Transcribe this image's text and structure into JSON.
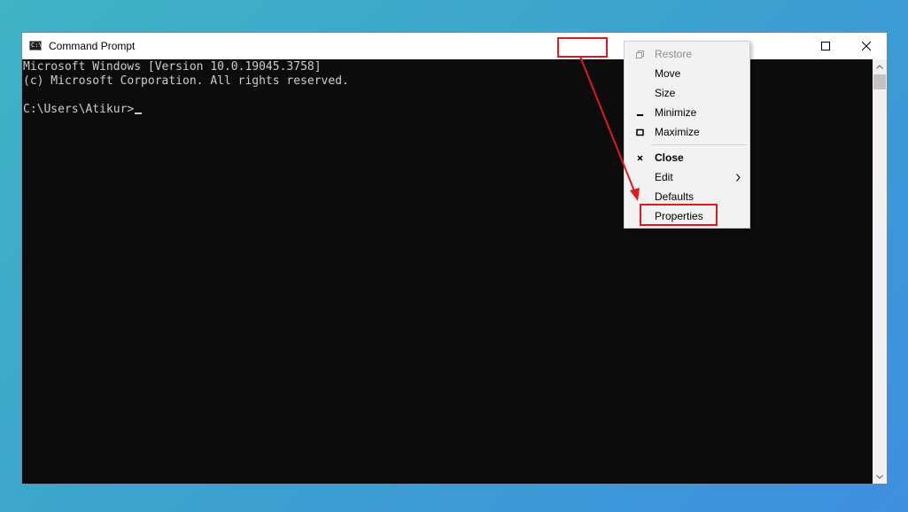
{
  "window": {
    "title": "Command Prompt",
    "app_icon_text": "C:\\"
  },
  "console": {
    "lines": [
      "Microsoft Windows [Version 10.0.19045.3758]",
      "(c) Microsoft Corporation. All rights reserved.",
      "",
      "C:\\Users\\Atikur>"
    ]
  },
  "system_menu": {
    "items": [
      {
        "label": "Restore",
        "icon": "restore-icon",
        "state": "disabled"
      },
      {
        "label": "Move",
        "icon": "",
        "state": "enabled"
      },
      {
        "label": "Size",
        "icon": "",
        "state": "enabled"
      },
      {
        "label": "Minimize",
        "icon": "minimize-icon",
        "state": "enabled"
      },
      {
        "label": "Maximize",
        "icon": "maximize-icon",
        "state": "enabled"
      },
      {
        "label": "Close",
        "icon": "close-icon",
        "state": "default"
      },
      {
        "label": "Edit",
        "icon": "chevron-right-icon",
        "state": "submenu"
      },
      {
        "label": "Defaults",
        "icon": "",
        "state": "enabled"
      },
      {
        "label": "Properties",
        "icon": "",
        "state": "highlighted"
      }
    ]
  },
  "annotation": {
    "color": "#e0191f"
  },
  "colors": {
    "console_bg": "#0c0c0c",
    "console_text": "#cccccc",
    "menu_bg": "#f2f2f2"
  }
}
